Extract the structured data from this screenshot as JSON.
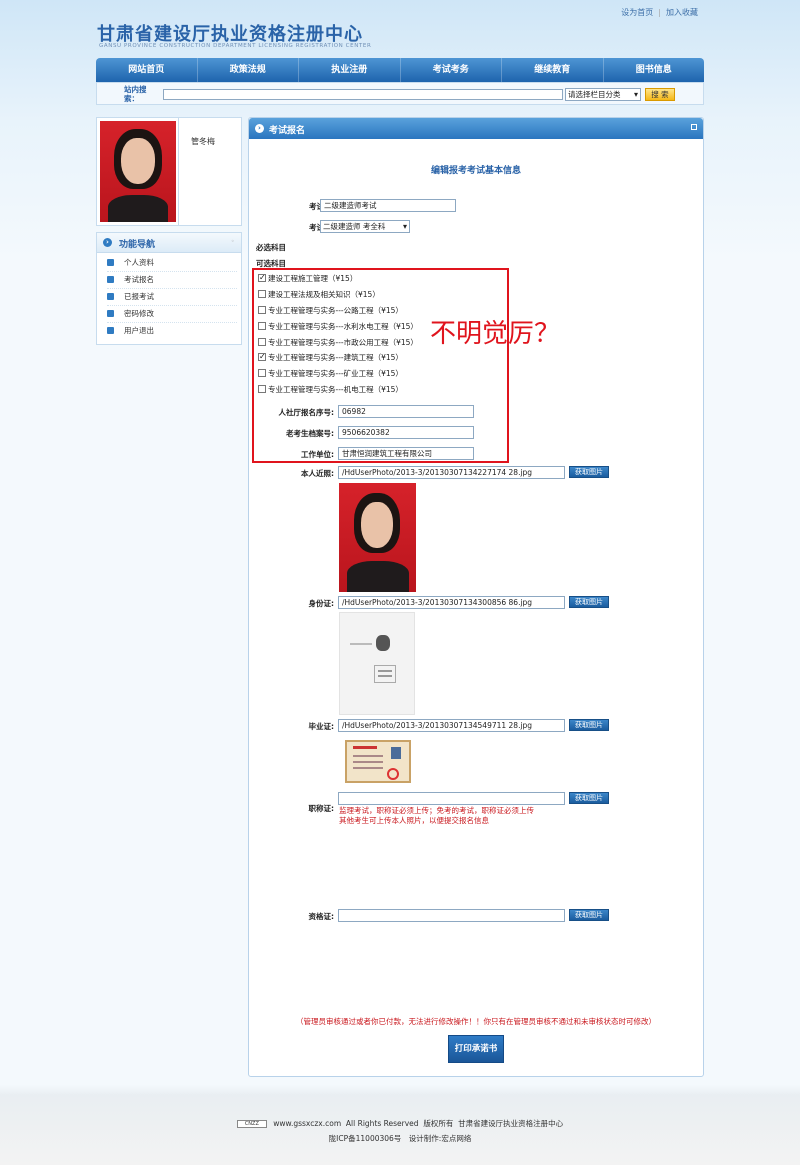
{
  "header": {
    "logo_cn": "甘肃省建设厅执业资格注册中心",
    "logo_en": "GANSU PROVINCE CONSTRUCTION DEPARTMENT LICENSING REGISTRATION CENTER",
    "links": [
      "设为首页",
      "加入收藏"
    ]
  },
  "nav": [
    "网站首页",
    "政策法规",
    "执业注册",
    "考试考务",
    "继续教育",
    "图书信息"
  ],
  "search": {
    "label": "站内搜索：",
    "select_value": "请选择栏目分类",
    "button": "搜 索"
  },
  "sidebar": {
    "user_name": "管冬梅",
    "func_title": "功能导航",
    "items": [
      "个人资料",
      "考试报名",
      "已报考试",
      "密码修改",
      "用户退出"
    ]
  },
  "panel": {
    "title": "考试报名",
    "subtitle": "编辑报考考试基本信息",
    "exam_name_label": "考试名称:",
    "exam_name_value": "二级建造师考试",
    "exam_type_label": "考试类型:",
    "exam_type_value": "二级建造师 考全科",
    "required_label": "必选科目",
    "optional_label": "可选科目",
    "subjects": [
      {
        "label": "建设工程施工管理（¥15）",
        "checked": true
      },
      {
        "label": "建设工程法规及相关知识（¥15）",
        "checked": false
      },
      {
        "label": "专业工程管理与实务---公路工程（¥15）",
        "checked": false
      },
      {
        "label": "专业工程管理与实务---水利水电工程（¥15）",
        "checked": false
      },
      {
        "label": "专业工程管理与实务---市政公用工程（¥15）",
        "checked": false
      },
      {
        "label": "专业工程管理与实务---建筑工程（¥15）",
        "checked": true
      },
      {
        "label": "专业工程管理与实务---矿业工程（¥15）",
        "checked": false
      },
      {
        "label": "专业工程管理与实务---机电工程（¥15）",
        "checked": false
      }
    ],
    "reg_no_label": "人社厅报名序号:",
    "reg_no_value": "06982",
    "archive_label": "老考生档案号:",
    "archive_value": "9506620382",
    "employer_label": "工作单位:",
    "employer_value": "甘肃恒润建筑工程有限公司",
    "photo_label": "本人近照:",
    "photo_path": "/HdUserPhoto/2013-3/20130307134227174 28.jpg",
    "id_label": "身份证:",
    "id_path": "/HdUserPhoto/2013-3/20130307134300856 86.jpg",
    "grad_label": "毕业证:",
    "grad_path": "/HdUserPhoto/2013-3/20130307134549711 28.jpg",
    "title_cert_label": "职称证:",
    "title_cert_path": "",
    "qual_label": "资格证:",
    "qual_path": "",
    "get_image_btn": "获取图片",
    "title_cert_note_1": "监理考试，职称证必须上传；免考的考试，职称证必须上传",
    "title_cert_note_2": "其他考生可上传本人照片，以便提交报名信息",
    "bottom_warning": "（管理员审核通过或者你已付款，无法进行修改操作！！你只有在管理员审核不通过和未审核状态时可修改）",
    "print_btn": "打印承诺书"
  },
  "annotation": "不明觉厉？",
  "footer": {
    "line1_site": "www.gssxczx.com",
    "line1_rights": "All Rights Reserved",
    "line1_copy": "版权所有",
    "line1_org": "甘肃省建设厅执业资格注册中心",
    "line2": "陇ICP备11000306号　设计制作:宏点网络",
    "cnzz": "CNZZ"
  }
}
